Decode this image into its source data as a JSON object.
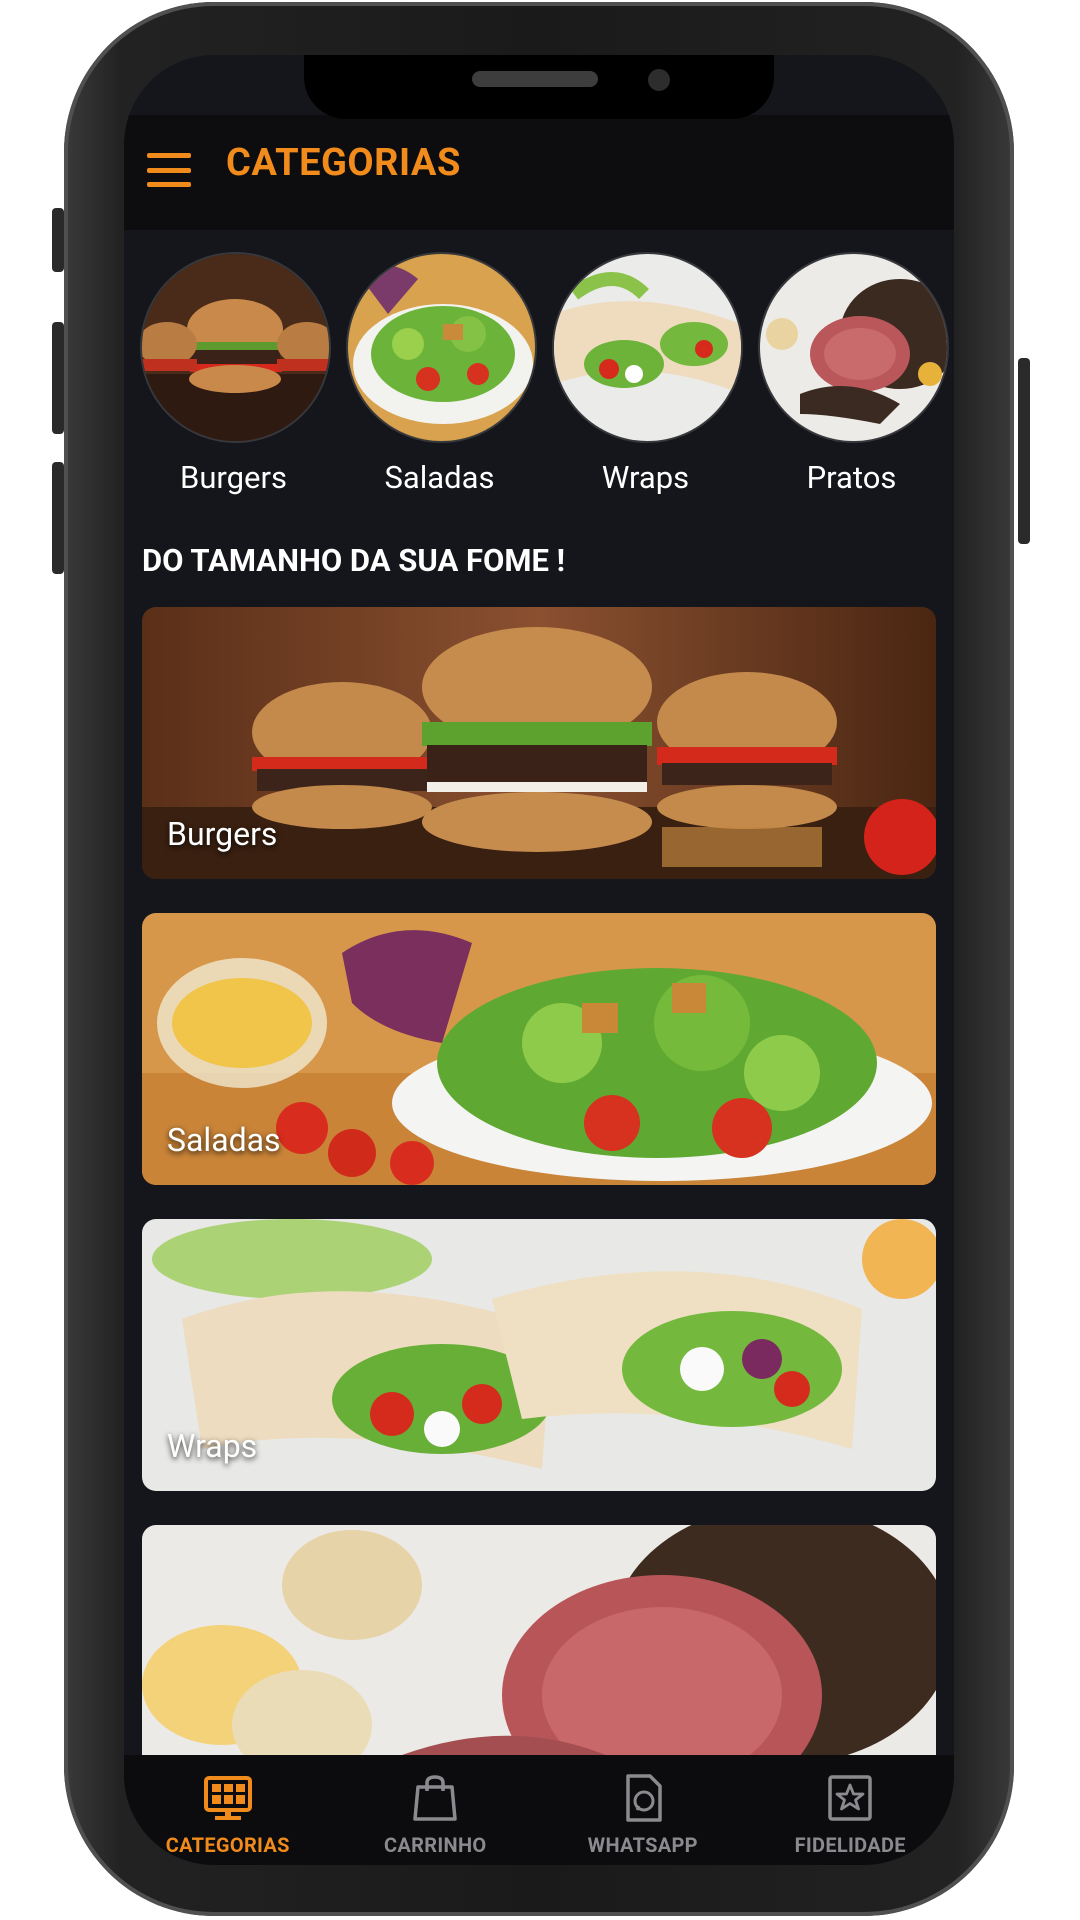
{
  "app": {
    "title": "CATEGORIAS"
  },
  "categories": [
    {
      "label": "Burgers"
    },
    {
      "label": "Saladas"
    },
    {
      "label": "Wraps"
    },
    {
      "label": "Pratos"
    }
  ],
  "section": {
    "title": "DO TAMANHO DA SUA FOME !"
  },
  "banners": [
    {
      "label": "Burgers"
    },
    {
      "label": "Saladas"
    },
    {
      "label": "Wraps"
    },
    {
      "label": ""
    }
  ],
  "bottom_nav": {
    "items": [
      {
        "label": "CATEGORIAS",
        "icon": "categories-icon",
        "active": true
      },
      {
        "label": "CARRINHO",
        "icon": "shopping-bag-icon",
        "active": false
      },
      {
        "label": "WHATSAPP",
        "icon": "whatsapp-document-icon",
        "active": false
      },
      {
        "label": "FIDELIDADE",
        "icon": "star-loyalty-icon",
        "active": false
      }
    ]
  },
  "colors": {
    "accent": "#f08b1c",
    "background": "#15161b",
    "inactive": "#8b8b8f"
  }
}
